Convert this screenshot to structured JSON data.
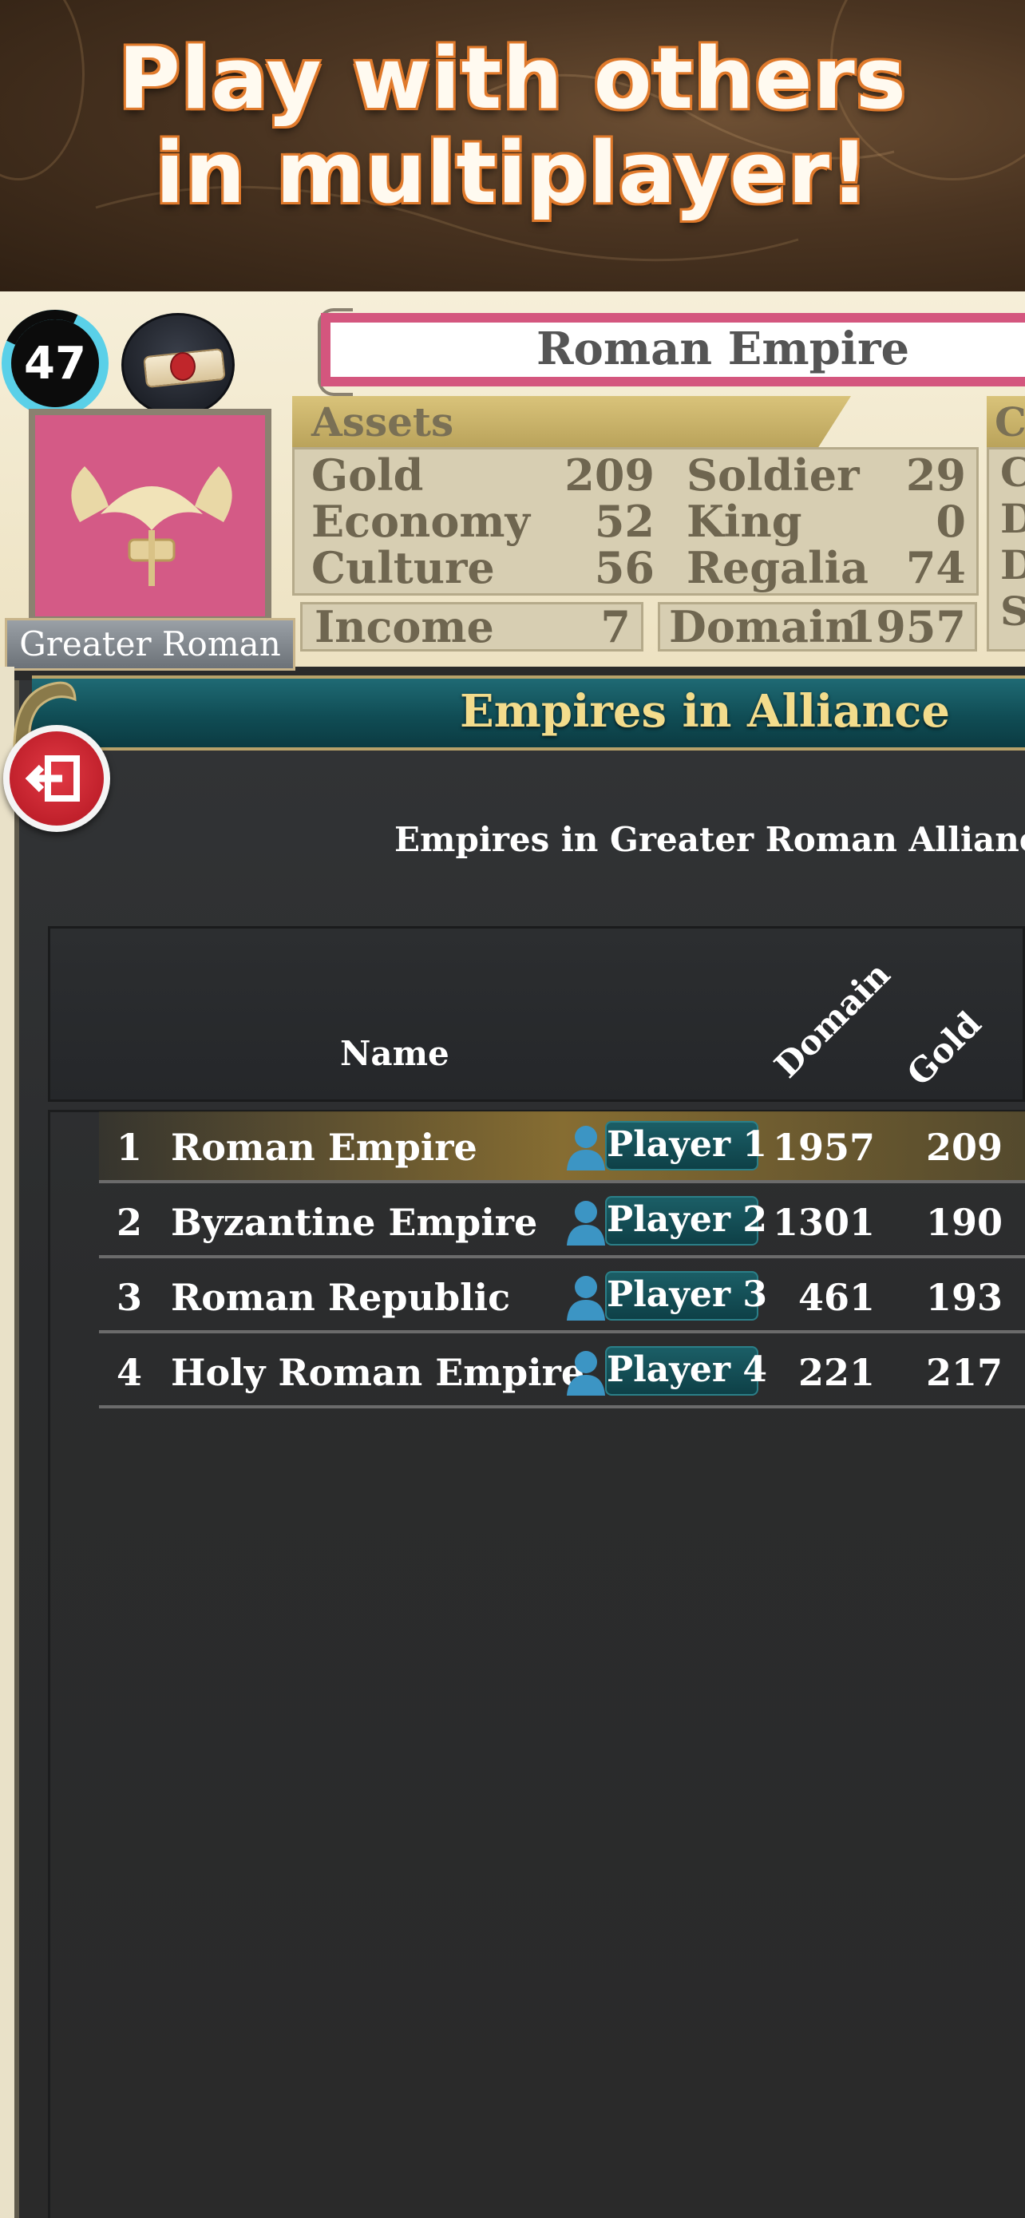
{
  "banner": {
    "line1": "Play with others",
    "line2": "in multiplayer!"
  },
  "player": {
    "level": "47",
    "faction": "Greater Roman"
  },
  "empire": {
    "name": "Roman Empire"
  },
  "assets": {
    "title": "Assets",
    "gold_label": "Gold",
    "gold": "209",
    "economy_label": "Economy",
    "economy": "52",
    "culture_label": "Culture",
    "culture": "56",
    "soldier_label": "Soldier",
    "soldier": "29",
    "king_label": "King",
    "king": "0",
    "regalia_label": "Regalia",
    "regalia": "74",
    "income_label": "Income",
    "income": "7",
    "domain_label": "Domain",
    "domain": "1957"
  },
  "right_panel": {
    "tab": "C",
    "lines": [
      "C",
      "D",
      "D",
      "S"
    ]
  },
  "alliance": {
    "title": "Empires in Alliance",
    "subtitle": "Empires in Greater Roman Alliance",
    "columns": {
      "name": "Name",
      "domain": "Domain",
      "gold": "Gold"
    },
    "rows": [
      {
        "rank": "1",
        "name": "Roman Empire",
        "player": "Player 1",
        "domain": "1957",
        "gold": "209"
      },
      {
        "rank": "2",
        "name": "Byzantine Empire",
        "player": "Player 2",
        "domain": "1301",
        "gold": "190"
      },
      {
        "rank": "3",
        "name": "Roman Republic",
        "player": "Player 3",
        "domain": "461",
        "gold": "193"
      },
      {
        "rank": "4",
        "name": "Holy Roman Empire",
        "player": "Player 4",
        "domain": "221",
        "gold": "217"
      }
    ]
  },
  "colors": {
    "accent_teal": "#104d55",
    "level_ring": "#5ad0e8",
    "name_border": "#d4567e",
    "exit_red": "#c0202b"
  },
  "icons": [
    "scroll-icon",
    "spqr-eagle-icon",
    "exit-icon",
    "person-icon"
  ]
}
